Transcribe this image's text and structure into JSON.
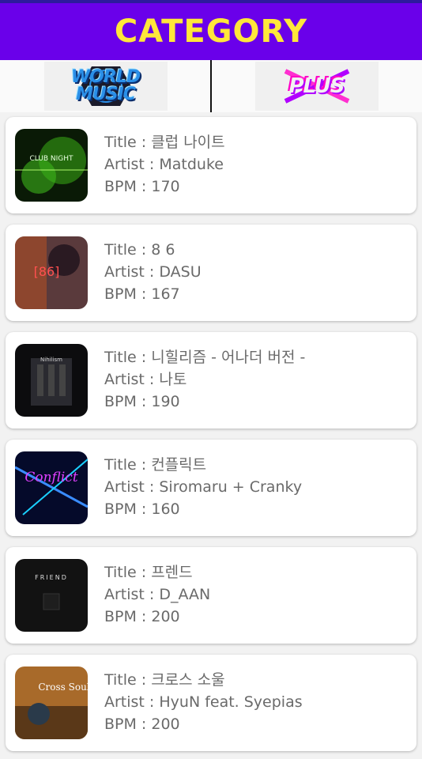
{
  "header": {
    "title": "CATEGORY",
    "bg": "#6a00ea",
    "title_color": "#ffe73a"
  },
  "tabs": [
    {
      "logo_text": "WORLD MUSIC",
      "icon": "world-music-logo"
    },
    {
      "logo_text": "PLUS",
      "icon": "plus-logo"
    }
  ],
  "songs": [
    {
      "title": "Title : 클럽 나이트",
      "artist": "Artist : Matduke",
      "bpm": "BPM : 170",
      "art_text": "CLUB NIGHT"
    },
    {
      "title": "Title : 8 6",
      "artist": "Artist : DASU",
      "bpm": "BPM : 167",
      "art_text": "[86]"
    },
    {
      "title": "Title : 니힐리즘 - 어나더 버전 -",
      "artist": "Artist : 나토",
      "bpm": "BPM : 190",
      "art_text": "Nihilism"
    },
    {
      "title": "Title : 컨플릭트",
      "artist": "Artist : Siromaru + Cranky",
      "bpm": "BPM : 160",
      "art_text": "Conflict"
    },
    {
      "title": "Title : 프렌드",
      "artist": "Artist : D_AAN",
      "bpm": "BPM : 200",
      "art_text": "FRIEND"
    },
    {
      "title": "Title : 크로스 소울",
      "artist": "Artist : HyuN feat. Syepias",
      "bpm": "BPM : 200",
      "art_text": "Cross Soul"
    }
  ]
}
